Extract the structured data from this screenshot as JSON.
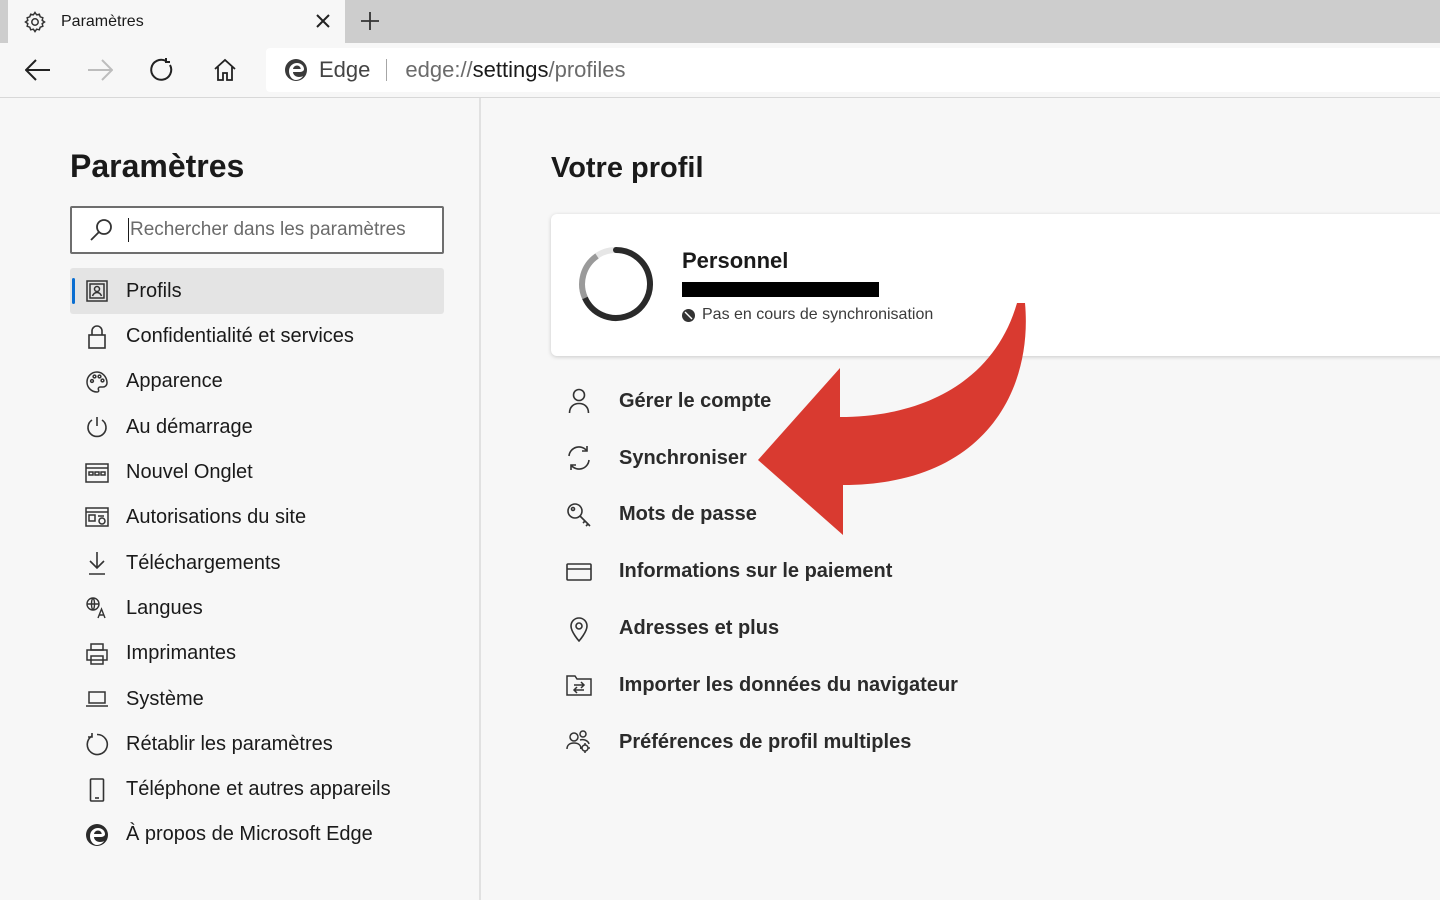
{
  "tab": {
    "title": "Paramètres",
    "icon": "gear-icon"
  },
  "toolbar": {
    "site_label": "Edge",
    "url_prefix": "edge://",
    "url_host": "settings",
    "url_path": "/profiles"
  },
  "sidebar": {
    "title": "Paramètres",
    "search_placeholder": "Rechercher dans les paramètres",
    "items": [
      {
        "label": "Profils",
        "icon": "profile-card-icon",
        "active": true
      },
      {
        "label": "Confidentialité et services",
        "icon": "lock-icon"
      },
      {
        "label": "Apparence",
        "icon": "palette-icon"
      },
      {
        "label": "Au démarrage",
        "icon": "power-icon"
      },
      {
        "label": "Nouvel Onglet",
        "icon": "new-tab-icon"
      },
      {
        "label": "Autorisations du site",
        "icon": "site-permissions-icon"
      },
      {
        "label": "Téléchargements",
        "icon": "download-icon"
      },
      {
        "label": "Langues",
        "icon": "languages-icon"
      },
      {
        "label": "Imprimantes",
        "icon": "printer-icon"
      },
      {
        "label": "Système",
        "icon": "laptop-icon"
      },
      {
        "label": "Rétablir les paramètres",
        "icon": "reset-icon"
      },
      {
        "label": "Téléphone et autres appareils",
        "icon": "phone-icon"
      },
      {
        "label": "À propos de Microsoft Edge",
        "icon": "edge-logo-icon"
      }
    ]
  },
  "main": {
    "title": "Votre profil",
    "profile": {
      "name": "Personnel",
      "sync_status": "Pas en cours de synchronisation"
    },
    "menu": [
      {
        "label": "Gérer le compte",
        "icon": "person-icon"
      },
      {
        "label": "Synchroniser",
        "icon": "sync-icon"
      },
      {
        "label": "Mots de passe",
        "icon": "key-icon"
      },
      {
        "label": "Informations sur le paiement",
        "icon": "credit-card-icon"
      },
      {
        "label": "Adresses et plus",
        "icon": "location-pin-icon"
      },
      {
        "label": "Importer les données du navigateur",
        "icon": "import-icon"
      },
      {
        "label": "Préférences de profil multiples",
        "icon": "multiple-profiles-icon"
      }
    ]
  },
  "colors": {
    "accent": "#0a6ed1",
    "annotation_arrow": "#d93a30"
  }
}
